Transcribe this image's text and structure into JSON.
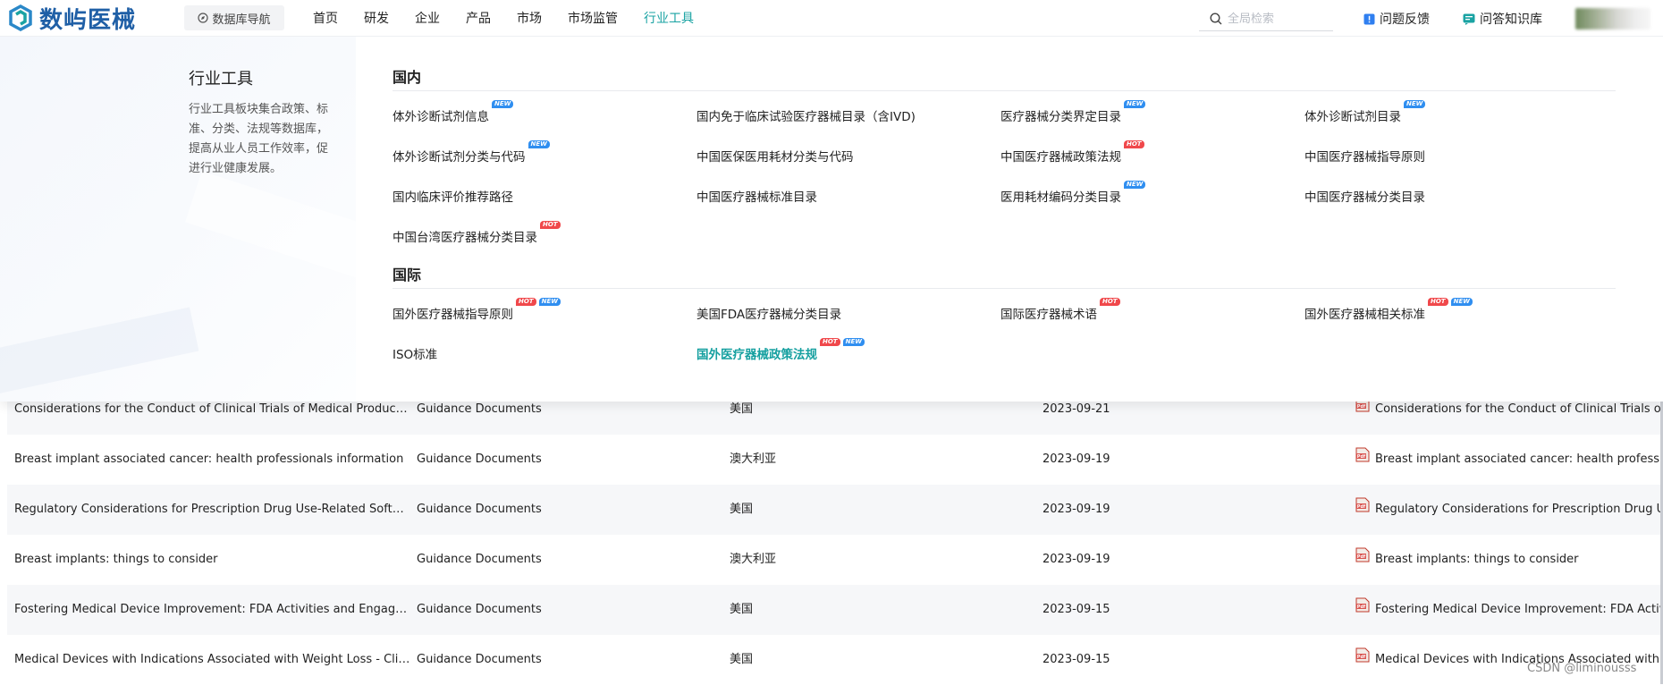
{
  "header": {
    "logo_text": "数屿医械",
    "db_nav": "数据库导航",
    "nav": [
      "首页",
      "研发",
      "企业",
      "产品",
      "市场",
      "市场监管",
      "行业工具"
    ],
    "active_nav": "行业工具",
    "search_placeholder": "全局检索",
    "feedback": "问题反馈",
    "knowledge_base": "问答知识库"
  },
  "mega_menu": {
    "title": "行业工具",
    "description": "行业工具板块集合政策、标准、分类、法规等数据库，提高从业人员工作效率，促进行业健康发展。",
    "domestic": {
      "title": "国内",
      "links": [
        {
          "label": "体外诊断试剂信息",
          "badges": [
            "new"
          ]
        },
        {
          "label": "国内免于临床试验医疗器械目录（含IVD)",
          "badges": []
        },
        {
          "label": "医疗器械分类界定目录",
          "badges": [
            "new"
          ]
        },
        {
          "label": "体外诊断试剂目录",
          "badges": [
            "new"
          ]
        },
        {
          "label": "体外诊断试剂分类与代码",
          "badges": [
            "new"
          ]
        },
        {
          "label": "中国医保医用耗材分类与代码",
          "badges": []
        },
        {
          "label": "中国医疗器械政策法规",
          "badges": [
            "hot"
          ]
        },
        {
          "label": "中国医疗器械指导原则",
          "badges": []
        },
        {
          "label": "国内临床评价推荐路径",
          "badges": []
        },
        {
          "label": "中国医疗器械标准目录",
          "badges": []
        },
        {
          "label": "医用耗材编码分类目录",
          "badges": [
            "new"
          ]
        },
        {
          "label": "中国医疗器械分类目录",
          "badges": []
        },
        {
          "label": "中国台湾医疗器械分类目录",
          "badges": [
            "hot"
          ]
        }
      ]
    },
    "international": {
      "title": "国际",
      "links": [
        {
          "label": "国外医疗器械指导原则",
          "badges": [
            "hot",
            "new"
          ]
        },
        {
          "label": "美国FDA医疗器械分类目录",
          "badges": []
        },
        {
          "label": "国际医疗器械术语",
          "badges": [
            "hot"
          ]
        },
        {
          "label": "国外医疗器械相关标准",
          "badges": [
            "hot",
            "new"
          ]
        },
        {
          "label": "ISO标准",
          "badges": []
        },
        {
          "label": "国外医疗器械政策法规",
          "badges": [
            "hot",
            "new"
          ],
          "highlight": true
        }
      ]
    },
    "badge_labels": {
      "hot": "HOT",
      "new": "NEW"
    }
  },
  "table": {
    "rows": [
      {
        "title": "Considerations for the Conduct of Clinical Trials of Medical Products Duri...",
        "type": "Guidance Documents",
        "region": "美国",
        "date": "2023-09-21",
        "file": "Considerations for the Conduct of Clinical Trials of Me"
      },
      {
        "title": "Breast implant associated cancer: health professionals information",
        "type": "Guidance Documents",
        "region": "澳大利亚",
        "date": "2023-09-19",
        "file": "Breast implant associated cancer: health professionals"
      },
      {
        "title": "Regulatory Considerations for Prescription Drug Use-Related Software",
        "type": "Guidance Documents",
        "region": "美国",
        "date": "2023-09-19",
        "file": "Regulatory Considerations for Prescription Drug Use-"
      },
      {
        "title": "Breast implants: things to consider",
        "type": "Guidance Documents",
        "region": "澳大利亚",
        "date": "2023-09-19",
        "file": "Breast implants: things to consider"
      },
      {
        "title": "Fostering Medical Device Improvement: FDA Activities and Engagement ...",
        "type": "Guidance Documents",
        "region": "美国",
        "date": "2023-09-15",
        "file": "Fostering Medical Device Improvement: FDA Activities"
      },
      {
        "title": "Medical Devices with Indications Associated with Weight Loss - Clinical St...",
        "type": "Guidance Documents",
        "region": "美国",
        "date": "2023-09-15",
        "file": "Medical Devices with Indications Associated with Weig"
      }
    ]
  },
  "watermark": "CSDN @liminousss",
  "colors": {
    "accent": "#1aa3a3",
    "logo": "#1f5fa6",
    "hot": "#f0484b",
    "new": "#2f8ef0"
  }
}
